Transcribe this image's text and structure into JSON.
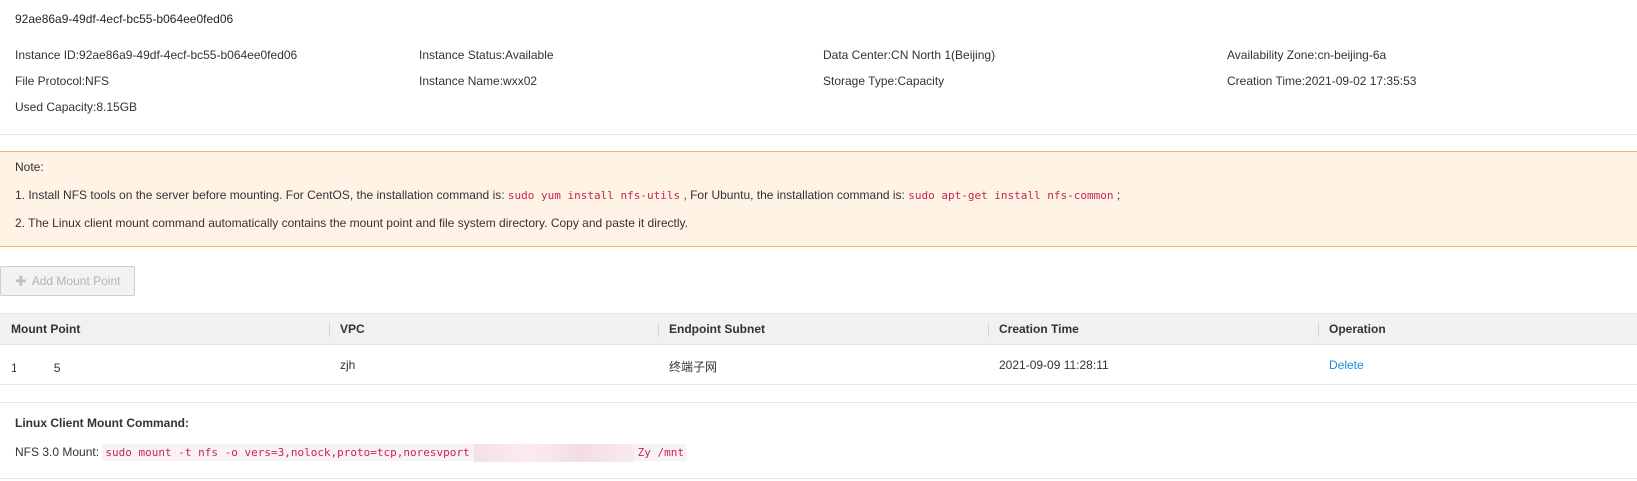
{
  "header": {
    "title": "92ae86a9-49df-4ecf-bc55-b064ee0fed06"
  },
  "details": {
    "instance_id": "Instance ID:92ae86a9-49df-4ecf-bc55-b064ee0fed06",
    "instance_status": "Instance Status:Available",
    "data_center": "Data Center:CN North 1(Beijing)",
    "availability_zone": "Availability Zone:cn-beijing-6a",
    "file_protocol": "File Protocol:NFS",
    "instance_name": "Instance Name:wxx02",
    "storage_type": "Storage Type:Capacity",
    "creation_time": "Creation Time:2021-09-02 17:35:53",
    "used_capacity": "Used Capacity:8.15GB"
  },
  "note": {
    "heading": "Note:",
    "line1_prefix": "1. Install NFS tools on the server before mounting. For CentOS, the installation command is:",
    "line1_code1": "sudo yum install nfs-utils",
    "line1_mid": ", For Ubuntu, the installation command is:",
    "line1_code2": "sudo apt-get install nfs-common",
    "line1_suffix": ";",
    "line2": "2. The Linux client mount command automatically contains the mount point and file system directory. Copy and paste it directly."
  },
  "toolbar": {
    "add_mount_point_label": "Add Mount Point"
  },
  "table": {
    "columns": [
      "Mount Point",
      "VPC",
      "Endpoint Subnet",
      "Creation Time",
      "Operation"
    ],
    "rows": [
      {
        "mount_point_start": "1",
        "mount_point_end": "5",
        "vpc": "zjh",
        "endpoint_subnet": "终端子网",
        "creation_time": "2021-09-09 11:28:11",
        "operation": "Delete"
      }
    ]
  },
  "mount_command": {
    "title": "Linux Client Mount Command:",
    "label": "NFS 3.0 Mount:",
    "code_prefix": "sudo mount -t nfs -o vers=3,nolock,proto=tcp,noresvport",
    "code_suffix": "Zy /mnt"
  }
}
